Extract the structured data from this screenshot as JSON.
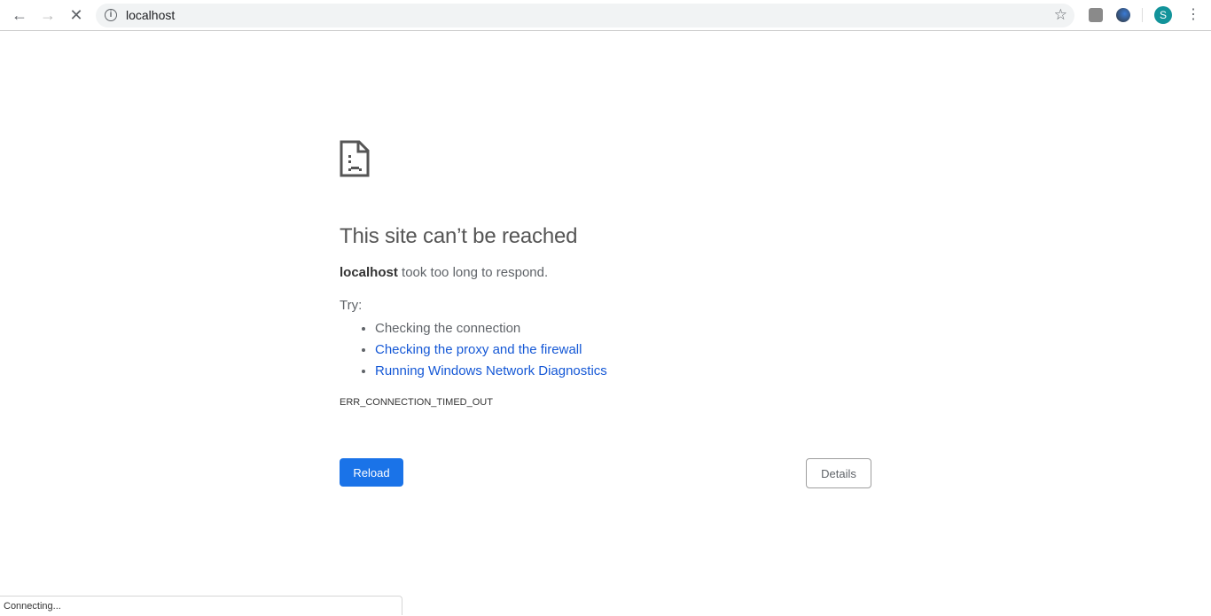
{
  "browser": {
    "back_icon": "arrow-left",
    "forward_icon": "arrow-right",
    "stop_icon": "close",
    "url": "localhost",
    "avatar_letter": "S",
    "accent": "#12939a"
  },
  "error": {
    "title": "This site can’t be reached",
    "host": "localhost",
    "message": " took too long to respond.",
    "try_label": "Try:",
    "suggestions": [
      "Checking the connection",
      "Checking the proxy and the firewall",
      "Running Windows Network Diagnostics"
    ],
    "code": "ERR_CONNECTION_TIMED_OUT",
    "reload_label": "Reload",
    "details_label": "Details"
  },
  "status_bar": {
    "text": "Connecting..."
  },
  "colors": {
    "link": "#1558d6",
    "button": "#1a73e8"
  }
}
